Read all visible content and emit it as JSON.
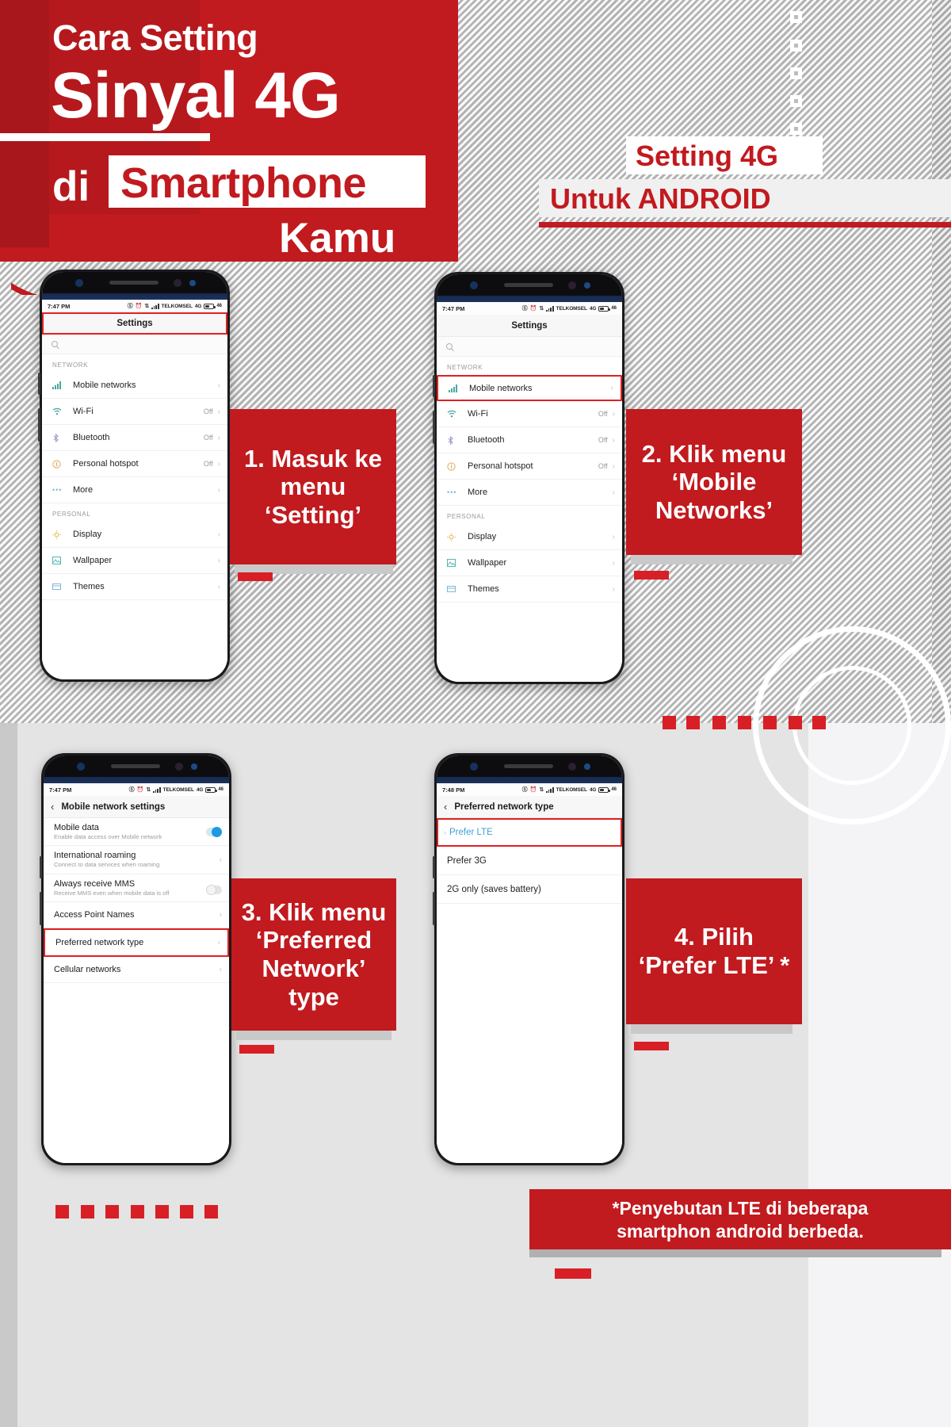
{
  "header": {
    "line1": "Cara Setting",
    "line2": "Sinyal 4G",
    "line3_pre": "di",
    "line3_highlight": "Smartphone",
    "line4": "Kamu",
    "badge_line1": "Setting 4G",
    "badge_line2": "Untuk ANDROID",
    "accent_color": "#c11a1f"
  },
  "steps": [
    {
      "id": "step-1",
      "text": "1. Masuk ke menu ‘Setting’"
    },
    {
      "id": "step-2",
      "text": "2. Klik menu ‘Mobile Networks’"
    },
    {
      "id": "step-3",
      "text": "3. Klik menu ‘Preferred Network’ type"
    },
    {
      "id": "step-4",
      "text": "4. Pilih ‘Prefer LTE’ *"
    }
  ],
  "phones": [
    {
      "id": "phone-settings",
      "status": {
        "time": "7:47 PM",
        "carrier": "TELKOMSEL",
        "network": "4G",
        "battery": "46"
      },
      "appbar_title": "Settings",
      "appbar_highlight": true,
      "search_placeholder": "",
      "sections": [
        {
          "header": "NETWORK",
          "rows": [
            {
              "icon": "signal-bars-icon",
              "label": "Mobile networks",
              "value": "",
              "highlight": false
            },
            {
              "icon": "wifi-icon",
              "label": "Wi-Fi",
              "value": "Off",
              "highlight": false
            },
            {
              "icon": "bluetooth-icon",
              "label": "Bluetooth",
              "value": "Off",
              "highlight": false
            },
            {
              "icon": "hotspot-icon",
              "label": "Personal hotspot",
              "value": "Off",
              "highlight": false
            },
            {
              "icon": "more-dots-icon",
              "label": "More",
              "value": "",
              "highlight": false
            }
          ]
        },
        {
          "header": "PERSONAL",
          "rows": [
            {
              "icon": "display-icon",
              "label": "Display",
              "value": "",
              "highlight": false
            },
            {
              "icon": "wallpaper-icon",
              "label": "Wallpaper",
              "value": "",
              "highlight": false
            },
            {
              "icon": "themes-icon",
              "label": "Themes",
              "value": "",
              "highlight": false
            }
          ]
        }
      ]
    },
    {
      "id": "phone-mobile-networks",
      "status": {
        "time": "7:47 PM",
        "carrier": "TELKOMSEL",
        "network": "4G",
        "battery": "46"
      },
      "appbar_title": "Settings",
      "appbar_highlight": false,
      "sections": [
        {
          "header": "NETWORK",
          "rows": [
            {
              "icon": "signal-bars-icon",
              "label": "Mobile networks",
              "value": "",
              "highlight": true
            },
            {
              "icon": "wifi-icon",
              "label": "Wi-Fi",
              "value": "Off",
              "highlight": false
            },
            {
              "icon": "bluetooth-icon",
              "label": "Bluetooth",
              "value": "Off",
              "highlight": false
            },
            {
              "icon": "hotspot-icon",
              "label": "Personal hotspot",
              "value": "Off",
              "highlight": false
            },
            {
              "icon": "more-dots-icon",
              "label": "More",
              "value": "",
              "highlight": false
            }
          ]
        },
        {
          "header": "PERSONAL",
          "rows": [
            {
              "icon": "display-icon",
              "label": "Display",
              "value": "",
              "highlight": false
            },
            {
              "icon": "wallpaper-icon",
              "label": "Wallpaper",
              "value": "",
              "highlight": false
            },
            {
              "icon": "themes-icon",
              "label": "Themes",
              "value": "",
              "highlight": false
            }
          ]
        }
      ]
    },
    {
      "id": "phone-network-settings",
      "status": {
        "time": "7:47 PM",
        "carrier": "TELKOMSEL",
        "network": "4G",
        "battery": "46"
      },
      "appbar_title": "Mobile network settings",
      "rows": [
        {
          "title": "Mobile data",
          "subtitle": "Enable data access over Mobile network",
          "control": "toggle-on",
          "highlight": false
        },
        {
          "title": "International roaming",
          "subtitle": "Connect to data services when roaming",
          "control": "chevron",
          "highlight": false
        },
        {
          "title": "Always receive MMS",
          "subtitle": "Receive MMS even when mobile data is off",
          "control": "toggle-off",
          "highlight": false
        },
        {
          "title": "Access Point Names",
          "subtitle": "",
          "control": "chevron",
          "highlight": false
        },
        {
          "title": "Preferred network type",
          "subtitle": "",
          "control": "chevron",
          "highlight": true
        },
        {
          "title": "Cellular networks",
          "subtitle": "",
          "control": "chevron",
          "highlight": false
        }
      ]
    },
    {
      "id": "phone-preferred-network-type",
      "status": {
        "time": "7:48 PM",
        "carrier": "TELKOMSEL",
        "network": "4G",
        "battery": "46"
      },
      "appbar_title": "Preferred network type",
      "options": [
        {
          "label": "Prefer LTE",
          "selected": true
        },
        {
          "label": "Prefer 3G",
          "selected": false
        },
        {
          "label": "2G only (saves battery)",
          "selected": false
        }
      ]
    }
  ],
  "footnote": {
    "line1": "*Penyebutan LTE di beberapa",
    "line2": "smartphon android berbeda."
  },
  "decor": {
    "white_square_count": 5,
    "red_dot_row_top_count": 7,
    "red_dot_row_bottom_count": 7
  }
}
